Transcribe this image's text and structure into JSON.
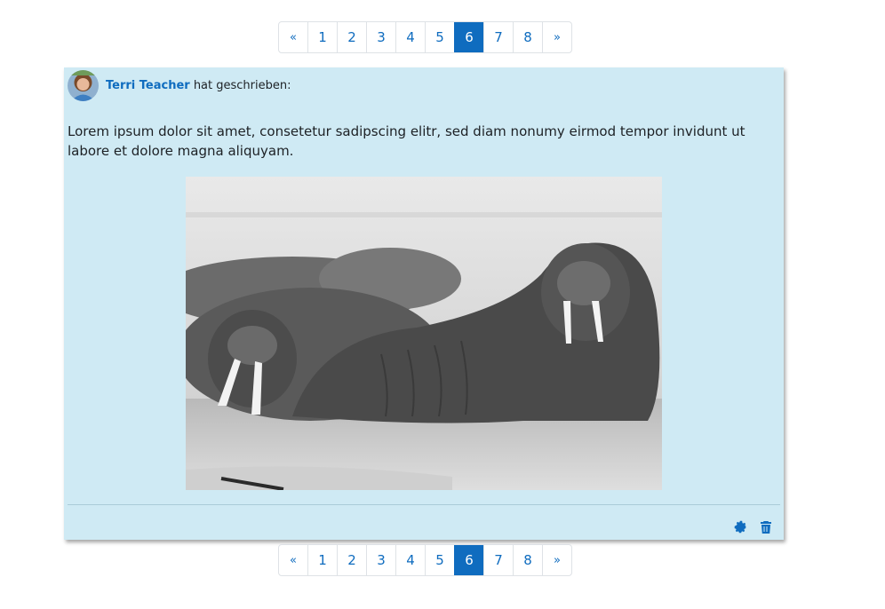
{
  "pagination": {
    "prev": "«",
    "next": "»",
    "pages": [
      "1",
      "2",
      "3",
      "4",
      "5",
      "6",
      "7",
      "8"
    ],
    "active_page": "6"
  },
  "post": {
    "author": "Terri Teacher",
    "author_suffix": " hat geschrieben:",
    "body": "Lorem ipsum dolor sit amet, consetetur sadipscing elitr, sed diam nonumy eirmod tempor invidunt ut labore et dolore magna aliquyam.",
    "image_alt": "walrus-photo",
    "actions": [
      {
        "icon": "gear-icon"
      },
      {
        "icon": "trash-icon"
      }
    ]
  },
  "colors": {
    "accent": "#0f6cbf",
    "post_background": "#cfeaf4"
  }
}
